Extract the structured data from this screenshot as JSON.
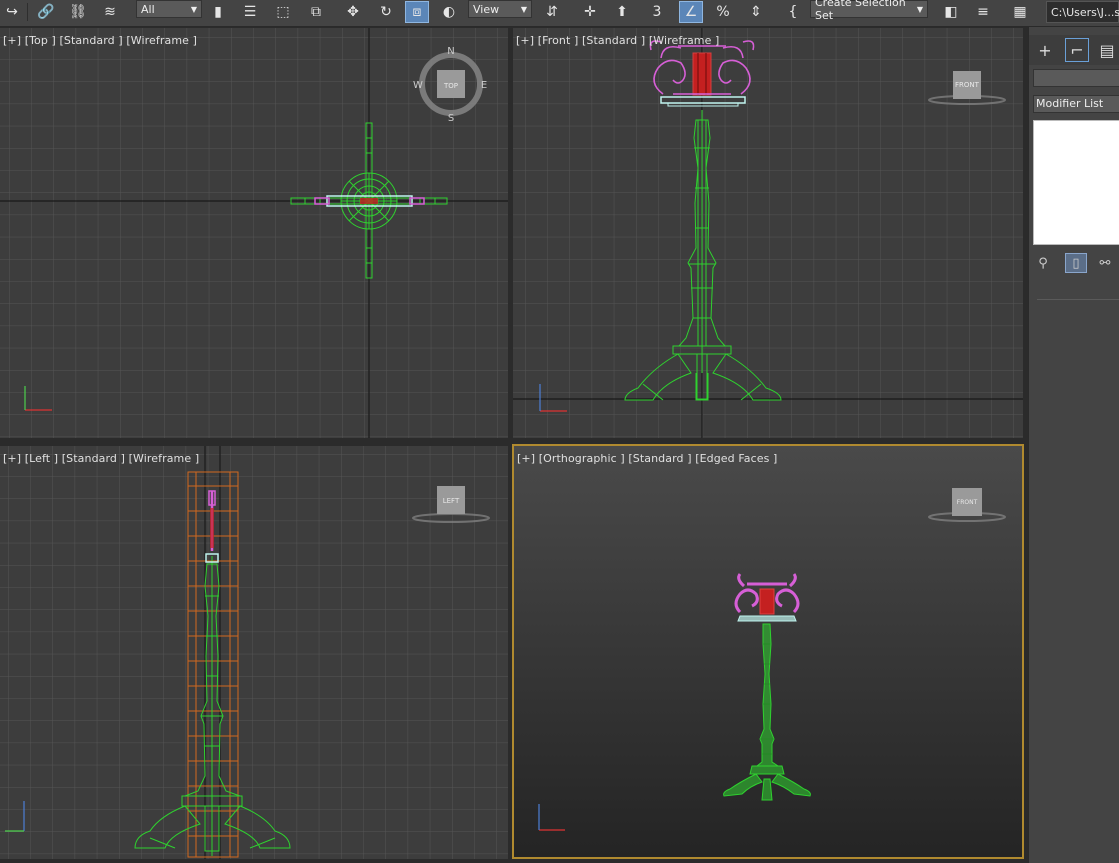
{
  "toolbar": {
    "icons": [
      "redo-icon",
      "link-icon",
      "unlink-icon",
      "bind-space-warp-icon"
    ],
    "selection_filter": "All",
    "view_dropdown": "View",
    "named_selection_placeholder": "Create Selection Set",
    "path_field": "C:\\Users\\J...s"
  },
  "viewports": {
    "top": {
      "label": "[+] [Top ] [Standard ] [Wireframe ]",
      "compass": {
        "n": "N",
        "s": "S",
        "e": "E",
        "w": "W",
        "cube": "TOP"
      }
    },
    "front": {
      "label": "[+] [Front ] [Standard ] [Wireframe ]",
      "cube": "FRONT"
    },
    "left": {
      "label": "[+] [Left ] [Standard ] [Wireframe ]",
      "cube": "LEFT"
    },
    "ortho": {
      "label": "[+] [Orthographic ] [Standard ] [Edged Faces ]",
      "cube": "FRONT"
    }
  },
  "command_panel": {
    "modifier_list": "Modifier List"
  },
  "colors": {
    "wire_green": "#2fd12f",
    "wire_pink": "#d65fd6",
    "wire_red": "#c42020",
    "wire_cyan": "#bff3ee",
    "bbox_orange": "#d2691e",
    "active_border": "#b08a2f"
  }
}
